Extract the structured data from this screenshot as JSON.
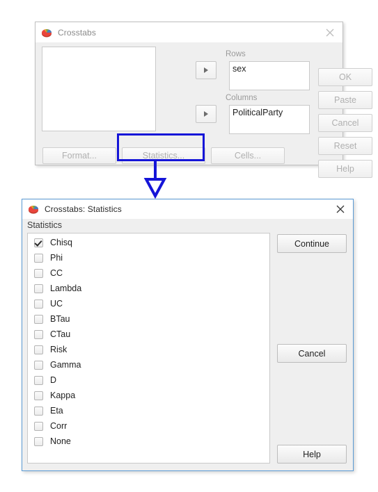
{
  "dialog_main": {
    "title": "Crosstabs",
    "icon": "pie-chart-icon",
    "close_icon": "close-icon",
    "source_list_items": [],
    "transfer_button_icon": "triangle-right-icon",
    "fields": [
      {
        "label": "Rows",
        "value": "sex"
      },
      {
        "label": "Columns",
        "value": "PoliticalParty"
      }
    ],
    "side_buttons": [
      {
        "label": "OK",
        "enabled": false
      },
      {
        "label": "Paste",
        "enabled": false
      },
      {
        "label": "Cancel",
        "enabled": false
      },
      {
        "label": "Reset",
        "enabled": false
      },
      {
        "label": "Help",
        "enabled": false
      }
    ],
    "bottom_buttons": [
      {
        "label": "Format...",
        "highlighted": false
      },
      {
        "label": "Statistics...",
        "highlighted": true
      },
      {
        "label": "Cells...",
        "highlighted": false
      }
    ]
  },
  "annotation": {
    "highlight_color": "#1515d8",
    "arrow_icon": "down-arrow-icon",
    "target": "Statistics..."
  },
  "dialog_statistics": {
    "title": "Crosstabs: Statistics",
    "icon": "pie-chart-icon",
    "close_icon": "close-icon",
    "group_label": "Statistics",
    "items": [
      {
        "label": "Chisq",
        "checked": true
      },
      {
        "label": "Phi",
        "checked": false
      },
      {
        "label": "CC",
        "checked": false
      },
      {
        "label": "Lambda",
        "checked": false
      },
      {
        "label": "UC",
        "checked": false
      },
      {
        "label": "BTau",
        "checked": false
      },
      {
        "label": "CTau",
        "checked": false
      },
      {
        "label": "Risk",
        "checked": false
      },
      {
        "label": "Gamma",
        "checked": false
      },
      {
        "label": "D",
        "checked": false
      },
      {
        "label": "Kappa",
        "checked": false
      },
      {
        "label": "Eta",
        "checked": false
      },
      {
        "label": "Corr",
        "checked": false
      },
      {
        "label": "None",
        "checked": false
      }
    ],
    "buttons": [
      {
        "label": "Continue"
      },
      {
        "label": "Cancel"
      },
      {
        "label": "Help"
      }
    ]
  }
}
